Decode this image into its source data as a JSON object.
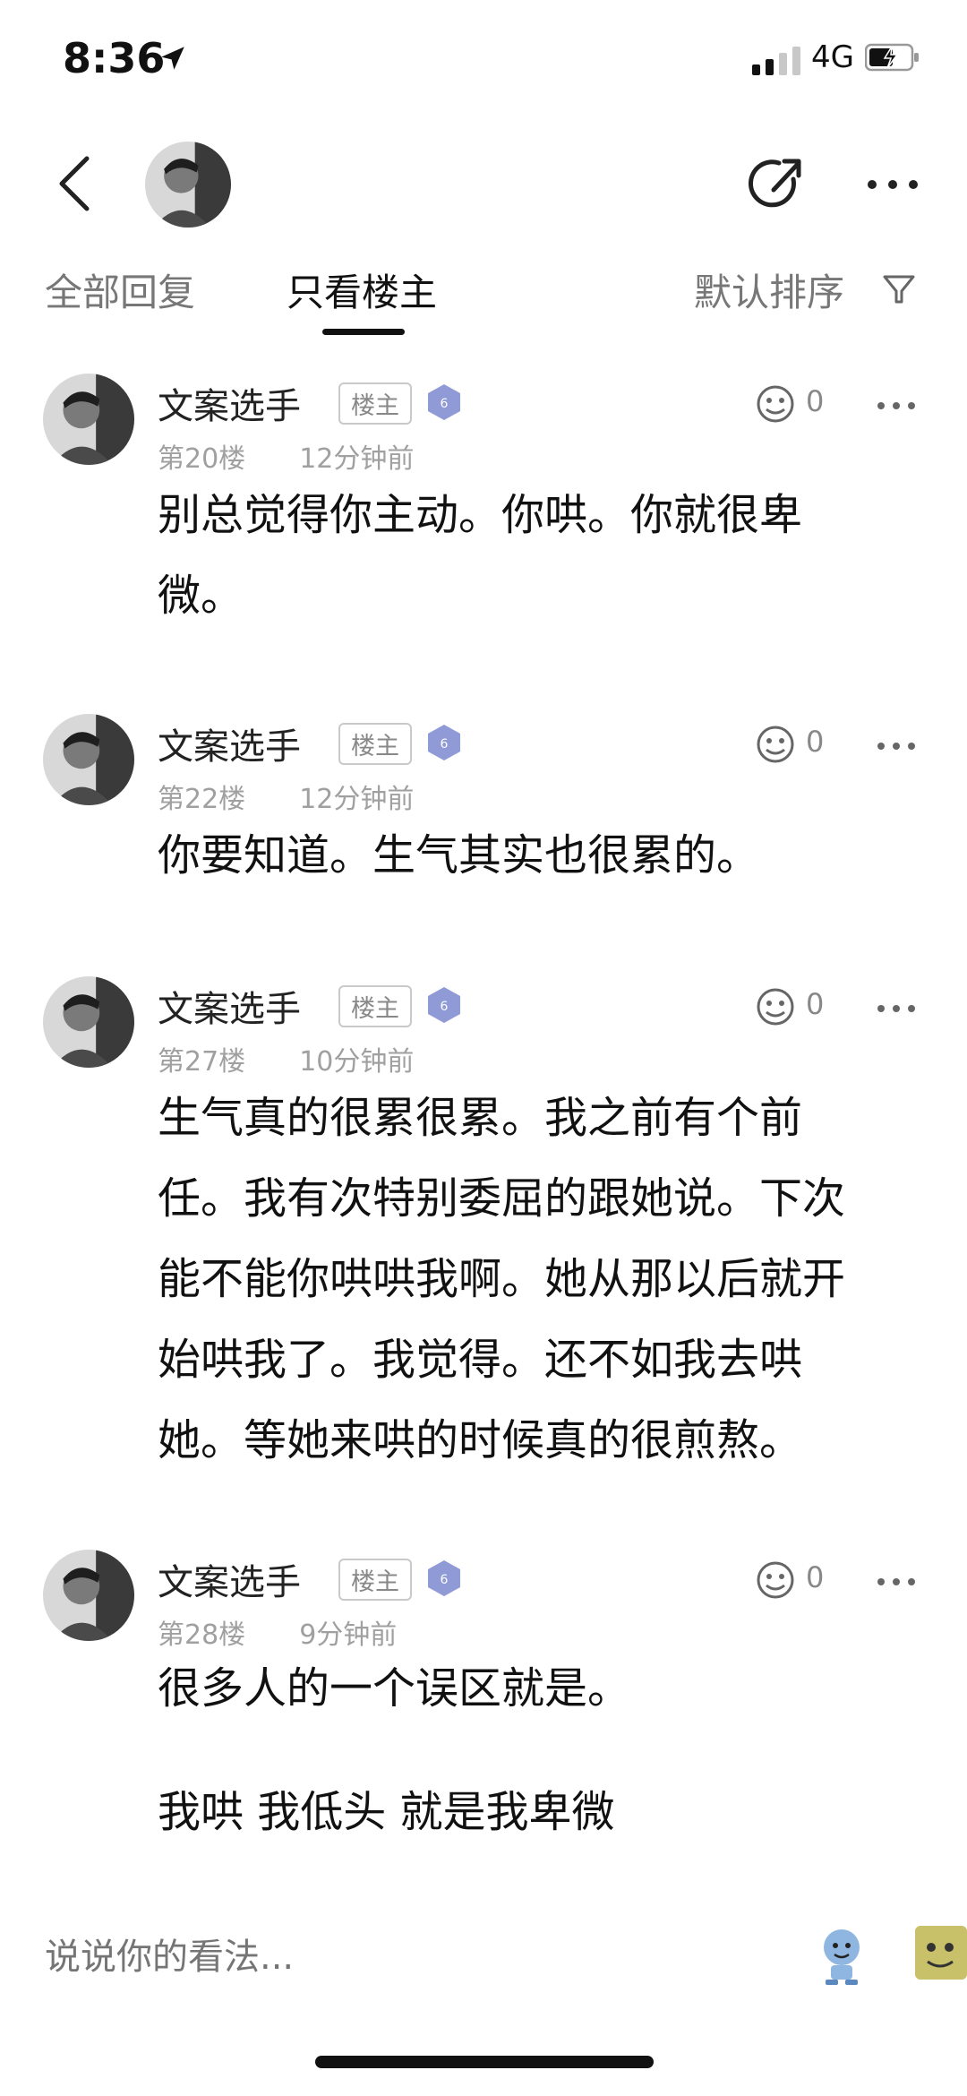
{
  "status_bar": {
    "time": "8:36",
    "network": "4G"
  },
  "tabs": [
    {
      "label": "全部回复",
      "active": false
    },
    {
      "label": "只看楼主",
      "active": true
    }
  ],
  "sort_label": "默认排序",
  "posts": [
    {
      "author": "文案选手",
      "badge": "楼主",
      "floor": "第20楼",
      "time": "12分钟前",
      "likes": "0",
      "lines": [
        "别总觉得你主动。你哄。你就很卑",
        "微。"
      ]
    },
    {
      "author": "文案选手",
      "badge": "楼主",
      "floor": "第22楼",
      "time": "12分钟前",
      "likes": "0",
      "lines": [
        "你要知道。生气其实也很累的。"
      ]
    },
    {
      "author": "文案选手",
      "badge": "楼主",
      "floor": "第27楼",
      "time": "10分钟前",
      "likes": "0",
      "lines": [
        "生气真的很累很累。我之前有个前",
        "任。我有次特别委屈的跟她说。下次",
        "能不能你哄哄我啊。她从那以后就开",
        "始哄我了。我觉得。还不如我去哄",
        "她。等她来哄的时候真的很煎熬。"
      ]
    },
    {
      "author": "文案选手",
      "badge": "楼主",
      "floor": "第28楼",
      "time": "9分钟前",
      "likes": "0",
      "lines": [
        "很多人的一个误区就是。",
        "我哄 我低头 就是我卑微"
      ]
    }
  ],
  "reply_bar": {
    "placeholder": "说说你的看法..."
  },
  "icons": {
    "back": "chevron-left-icon",
    "share": "share-icon",
    "more": "more-horizontal-icon",
    "filter": "filter-icon",
    "like": "like-icon",
    "level": "diamond-level-icon"
  },
  "colors": {
    "text": "#111111",
    "secondary": "#a0a0a0",
    "badge_border": "#c9c9c9",
    "level": "#8f9ad6"
  }
}
